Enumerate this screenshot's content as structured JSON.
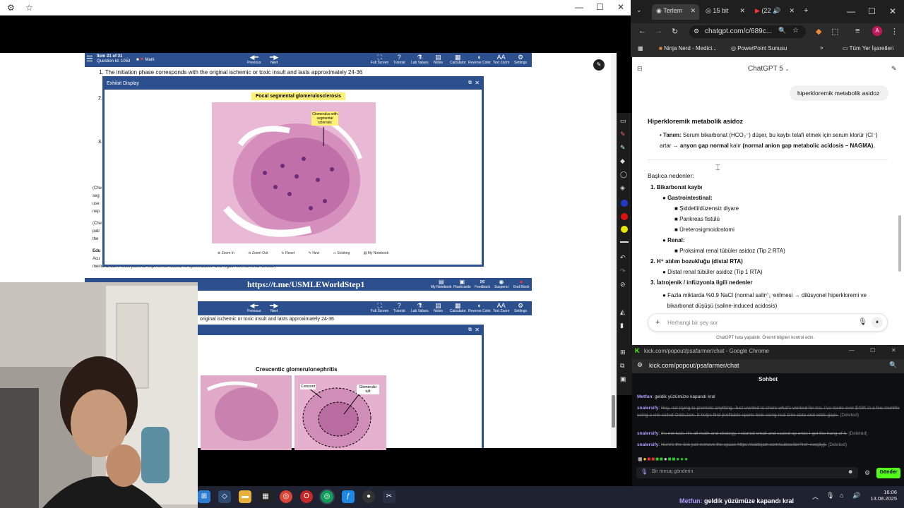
{
  "left_window": {
    "uworld": {
      "item_label": "Item 21 of 31",
      "question_id": "Question Id: 1053",
      "mark": "Mark",
      "previous": "Previous",
      "next": "Next",
      "tools": [
        "Full Screen",
        "Tutorial",
        "Lab Values",
        "Notes",
        "Calculator",
        "Reverse Color",
        "Text Zoom",
        "Settings"
      ],
      "question_text": "1. The initiation phase corresponds with the original ischemic or toxic insult and lasts approximately 24-36",
      "lower_question_text": "original ischemic or toxic insult and lasts approximately 24-36",
      "side_labels": [
        "(Che",
        "seg",
        "use",
        "nep",
        "(Che",
        "pati",
        "the",
        "Edu",
        "Acu",
        "memorandum"
      ],
      "side_numbers": [
        "2.",
        "3."
      ],
      "exhibit": {
        "header": "Exhibit Display",
        "title": "Focal segmental glomerulosclerosis",
        "callout": "Glomerulus with segmental sclerosis",
        "tools": [
          "Zoom In",
          "Zoom Out",
          "Reset",
          "New",
          "Existing",
          "My Notebook"
        ]
      },
      "lower_exhibit": {
        "title": "Crescentic glomerulonephritis",
        "callout_left": "Crescent",
        "callout_right": "Glomerular tuft"
      },
      "bottom_tools": [
        "My Notebook",
        "Flashcards",
        "Feedback",
        "Suspend",
        "End Block"
      ],
      "banner": "https://t.me/USMLEWorldStep1",
      "partial_line": "memorandum. Most patients experience tubular re-epithelization and regain normal renal function."
    }
  },
  "chrome": {
    "tabs": [
      {
        "label": "Terlem",
        "active": true
      },
      {
        "label": "15 bit"
      },
      {
        "label": "(22"
      }
    ],
    "url": "chatgpt.com/c/689c...",
    "bookmarks": [
      "Ninja Nerd - Medici...",
      "PowerPoint Sunusu",
      "Tüm Yer İşaretleri"
    ]
  },
  "chatgpt": {
    "model": "ChatGPT 5",
    "user_message": "hiperkloremik metabolik asidoz",
    "heading": "Hiperkloremik metabolik asidoz",
    "definition_label": "Tanım:",
    "definition_text": "Serum bikarbonat (HCO₃⁻) düşer, bu kaybı telafi etmek için serum klorür (Cl⁻)",
    "definition_line2": "artar →",
    "definition_bold": "anyon gap normal",
    "definition_tail": "kalır",
    "definition_bold2": "(normal anion gap metabolic acidosis – NAGMA).",
    "causes_title": "Başlıca nedenler:",
    "c1": "Bikarbonat kaybı",
    "c1_gi": "Gastrointestinal:",
    "c1_gi_items": [
      "Şiddetli/düzensiz diyare",
      "Pankreas fistülü",
      "Üreterosigmoidostomi"
    ],
    "c1_renal": "Renal:",
    "c1_renal_items": [
      "Proksimal renal tübüler asidoz (Tip 2 RTA)"
    ],
    "c2": "H⁺ atılım bozukluğu (distal RTA)",
    "c2_items": [
      "Distal renal tübüler asidoz (Tip 1 RTA)"
    ],
    "c3": "İatrojenik / infüzyonla ilgili nedenler",
    "c3_line1": "Fazla miktarda %0.9 NaCl (normal salin) verilmesi → dilüsyonel hiperkloremi ve",
    "c3_line2": "bikarbonat düşüşü (saline-induced acidosis)",
    "input_placeholder": "Herhangi bir şey sor",
    "disclaimer": "ChatGPT hata yapabilir. Önemli bilgileri kontrol edin."
  },
  "kick": {
    "window_title": "kick.com/popout/psafarmer/chat - Google Chrome",
    "url": "kick.com/popout/psafarmer/chat",
    "header": "Sohbet",
    "messages": [
      {
        "user": "Metfun",
        "text": "geldik yüzümüze kapandı kral",
        "deleted": false
      },
      {
        "user": "snalersify",
        "text": "Hey, not trying to promote anything. Just wanted to share what's worked for me. I've made over $40K in a few months using a site called OddsJam. It helps find profitable sports bets using real-time data and odds gaps.",
        "deleted": true
      },
      {
        "user": "snalersify",
        "text": "It's not luck. It's all math and strategy. I started small and scaled up once I got the hang of it.",
        "deleted": true
      },
      {
        "user": "snalersify",
        "text": "Here's the link just remove the space https://oddsjam.com/subscribe?ref=nwq3yjk",
        "deleted": true
      }
    ],
    "deleted_tag": "(Deleted)",
    "input_placeholder": "Bir mesaj gönderin",
    "send": "Gönder"
  },
  "taskbar": {
    "time": "16:06",
    "date": "13.08.2025"
  },
  "subtitle": {
    "user": "Metfun:",
    "text": "geldik yüzümüze kapandı kral"
  },
  "colors": {
    "uworld_blue": "#2c4f8e",
    "kick_green": "#53fc18",
    "yellow_label": "#fff176"
  }
}
